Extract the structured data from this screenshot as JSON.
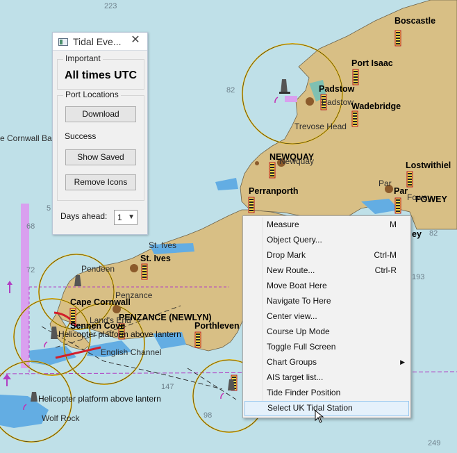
{
  "map": {
    "depths": [
      "223",
      "82",
      "68",
      "72",
      "5",
      "147",
      "98",
      "82",
      "193",
      "249"
    ],
    "places": {
      "boscastle": "Boscastle",
      "port_isaac": "Port Isaac",
      "padstow_bold": "Padstow",
      "padstow": "Padstow",
      "wadebridge": "Wadebridge",
      "trevose_head": "Trevose Head",
      "newquay_bold": "NEWQUAY",
      "newquay": "Newquay",
      "perranporth": "Perranporth",
      "lostwithiel": "Lostwithiel",
      "par_plain": "Par",
      "par_bold": "Par",
      "fowey_plain": "Fowey",
      "fowey_bold": "FOWEY",
      "st_ives_plain": "St. Ives",
      "st_ives_bold": "St. Ives",
      "pendeen": "Pendeen",
      "penzance": "Penzance",
      "cape_cornwall": "Cape Cornwall",
      "penzance_newlyn": "PENZANCE (NEWLYN)",
      "lands_end": "Land's End",
      "sennen_cove": "Sennen Cove",
      "porthleven": "Porthleven",
      "english_channel": "English Channel",
      "heli1": "Helicopter platform above lantern",
      "heli2": "Helicopter platform above lantern",
      "wolf_rock": "Wolf Rock",
      "cornwall_bank": "e Cornwall Ba",
      "mey": "ey"
    }
  },
  "panel": {
    "title": "Tidal Eve...",
    "close": "✕",
    "important_label": "Important",
    "times_text": "All times UTC",
    "port_label": "Port Locations",
    "download": "Download",
    "status": "Success",
    "show_saved": "Show Saved",
    "remove_icons": "Remove Icons",
    "days_label": "Days ahead:",
    "days_value": "1"
  },
  "menu": [
    {
      "label": "Measure",
      "shortcut": "M"
    },
    {
      "label": "Object Query...",
      "shortcut": ""
    },
    {
      "label": "Drop Mark",
      "shortcut": "Ctrl-M"
    },
    {
      "label": "New Route...",
      "shortcut": "Ctrl-R"
    },
    {
      "label": "Move Boat Here",
      "shortcut": ""
    },
    {
      "label": "Navigate To Here",
      "shortcut": ""
    },
    {
      "label": "Center view...",
      "shortcut": ""
    },
    {
      "label": "Course Up Mode",
      "shortcut": ""
    },
    {
      "label": "Toggle Full Screen",
      "shortcut": ""
    },
    {
      "label": "Chart Groups",
      "shortcut": ""
    },
    {
      "label": "AIS target list...",
      "shortcut": ""
    },
    {
      "label": "Tide Finder Position",
      "shortcut": ""
    },
    {
      "label": "Select UK Tidal Station",
      "shortcut": ""
    }
  ],
  "colors": {
    "sea": "#bfe0e8",
    "land": "#d8bf85",
    "shallow": "#63ade3",
    "menu_hover": "#e5f1fb"
  }
}
